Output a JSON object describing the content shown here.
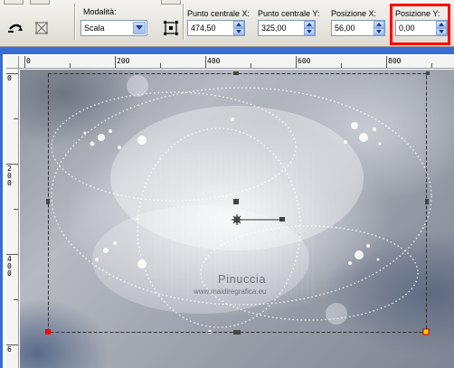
{
  "toolbar": {
    "modalita": {
      "label": "Modalità:",
      "value": "Scala"
    },
    "punto_centrale_x": {
      "label": "Punto centrale X:",
      "value": "474,50"
    },
    "punto_centrale_y": {
      "label": "Punto centrale Y:",
      "value": "325,00"
    },
    "posizione_x": {
      "label": "Posizione X:",
      "value": "56,00"
    },
    "posizione_y": {
      "label": "Posizione Y:",
      "value": "0,00"
    },
    "highlight_color": "#ff0000"
  },
  "rulers": {
    "horizontal": [
      "0",
      "200",
      "400",
      "600",
      "800"
    ],
    "vertical": [
      [
        "0"
      ],
      [
        "2",
        "0",
        "0"
      ],
      [
        "4",
        "0",
        "0"
      ],
      [
        "6"
      ]
    ]
  },
  "canvas": {
    "watermark_title": "Pinuccia",
    "watermark_url": "www.maidiregrafica.eu"
  },
  "icons": {
    "tool1": "undo-arrow-icon",
    "tool2": "deform-reset-icon",
    "tool3": "center-node-icon"
  },
  "colors": {
    "accent": "#3a6cd6",
    "control_border": "#7f9db9"
  }
}
